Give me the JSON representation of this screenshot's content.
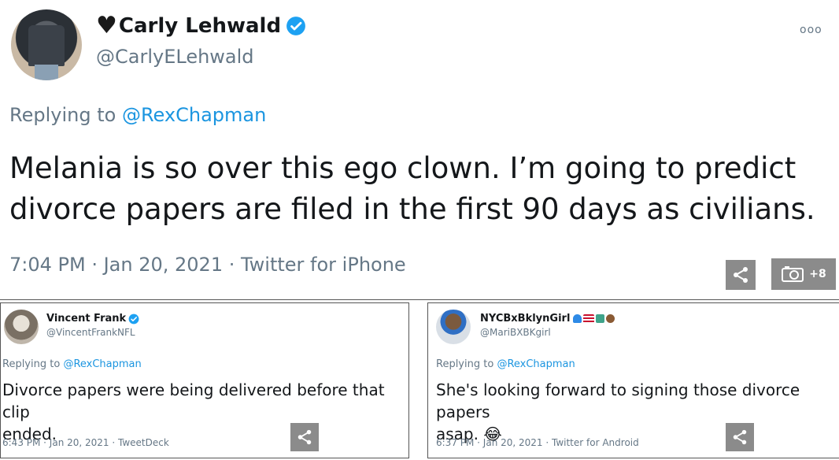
{
  "main_tweet": {
    "display_name": "Carly Lehwald",
    "handle": "@CarlyELehwald",
    "replying_prefix": "Replying to",
    "replying_to": "@RexChapman",
    "text": "Melania is so over this ego clown. I’m going to predict divorce papers are filed in the first 90 days as civilians.",
    "meta": "7:04 PM · Jan 20, 2021 · Twitter for iPhone",
    "more_label": "ooo",
    "photo_count": "+8"
  },
  "reply_left": {
    "display_name": "Vincent Frank",
    "handle": "@VincentFrankNFL",
    "replying_prefix": "Replying to",
    "replying_to": "@RexChapman",
    "text": "Divorce papers were being delivered before that clip\nended.",
    "meta": "6:43 PM · Jan 20, 2021 · TweetDeck"
  },
  "reply_right": {
    "display_name": "NYCBxBklynGirl",
    "handle": "@MariBXBKgirl",
    "replying_prefix": "Replying to",
    "replying_to": "@RexChapman",
    "text": "She's looking forward to signing those divorce papers\nasap. 😂",
    "meta": "6:37 PM · Jan 20, 2021 · Twitter for Android"
  },
  "colors": {
    "link": "#1b95e0",
    "secondary_text": "#657786",
    "share_button": "#8b8b8b"
  }
}
